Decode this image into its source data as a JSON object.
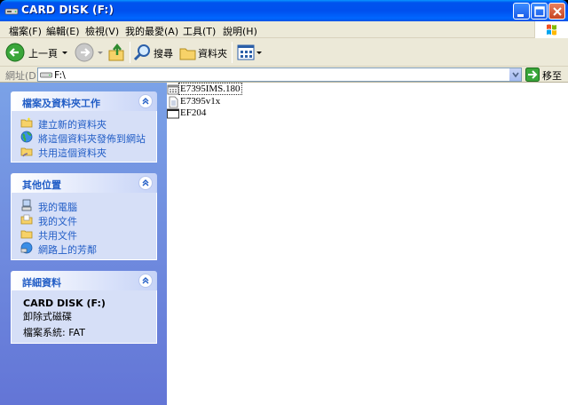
{
  "window": {
    "title": "CARD DISK (F:)"
  },
  "menubar": {
    "items": [
      "檔案(F)",
      "編輯(E)",
      "檢視(V)",
      "我的最愛(A)",
      "工具(T)",
      "說明(H)"
    ]
  },
  "toolbar": {
    "back_label": "上一頁",
    "search_label": "搜尋",
    "folders_label": "資料夾"
  },
  "address": {
    "label": "網址(D)",
    "value": "F:\\",
    "go_label": "移至"
  },
  "tasks_panel": {
    "title": "檔案及資料夾工作",
    "links": [
      "建立新的資料夾",
      "將這個資料夾發佈到網站",
      "共用這個資料夾"
    ]
  },
  "places_panel": {
    "title": "其他位置",
    "links": [
      "我的電腦",
      "我的文件",
      "共用文件",
      "網路上的芳鄰"
    ]
  },
  "details_panel": {
    "title": "詳細資料",
    "name": "CARD DISK (F:)",
    "type": "卸除式磁碟",
    "filesystem": "檔案系統: FAT"
  },
  "files": [
    {
      "name": "E7395IMS.180",
      "icon": "bin-file-icon"
    },
    {
      "name": "E7395v1x",
      "icon": "text-file-icon"
    },
    {
      "name": "EF204",
      "icon": "app-window-icon"
    }
  ],
  "colors": {
    "title_blue": "#0053ee",
    "panel_link": "#215dc6",
    "pane_bg": "#6d8ce0"
  }
}
